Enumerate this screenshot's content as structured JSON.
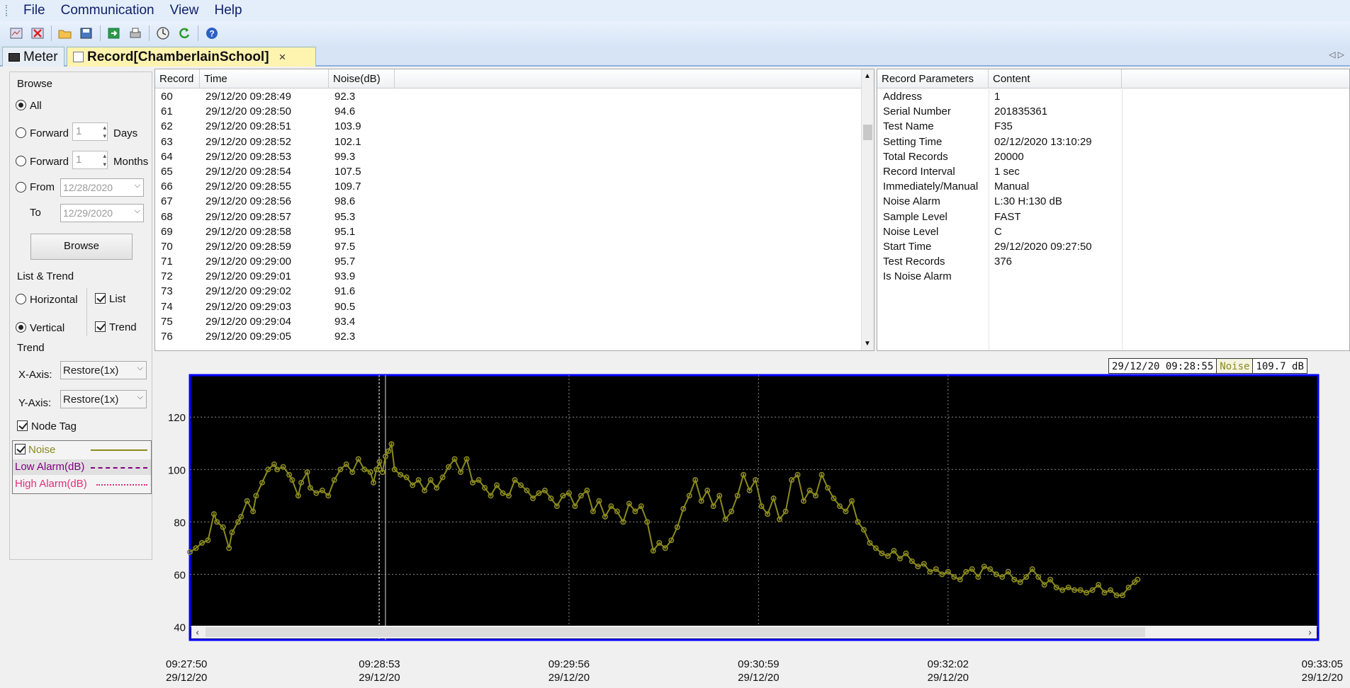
{
  "menu": {
    "items": [
      "File",
      "Communication",
      "View",
      "Help"
    ]
  },
  "toolbar": {
    "icons": [
      "view-icon",
      "delete-icon",
      "open-folder-icon",
      "save-icon",
      "export-icon",
      "print-icon",
      "clock-icon",
      "refresh-icon",
      "help-icon"
    ]
  },
  "tabs": [
    {
      "label": "Meter",
      "icon": "meter-icon"
    },
    {
      "label": "Record[ChamberlainSchool]",
      "icon": "record-icon",
      "close": "×"
    }
  ],
  "browse": {
    "group_label": "Browse",
    "all_label": "All",
    "forward_label": "Forward",
    "forward_days_value": "1",
    "days_label": "Days",
    "forward_months_value": "1",
    "months_label": "Months",
    "from_label": "From",
    "from_value": "12/28/2020",
    "to_label": "To",
    "to_value": "12/29/2020",
    "browse_button": "Browse"
  },
  "list_trend": {
    "group_label": "List & Trend",
    "horizontal_label": "Horizontal",
    "vertical_label": "Vertical",
    "list_label": "List",
    "trend_label": "Trend"
  },
  "trend": {
    "group_label": "Trend",
    "x_axis_label": "X-Axis:",
    "x_axis_value": "Restore(1x)",
    "y_axis_label": "Y-Axis:",
    "y_axis_value": "Restore(1x)",
    "node_tag_label": "Node Tag"
  },
  "legend": {
    "noise": "Noise",
    "low_alarm": "Low Alarm(dB)",
    "high_alarm": "High Alarm(dB)"
  },
  "records_table": {
    "columns": [
      "Record",
      "Time",
      "Noise(dB)"
    ],
    "rows": [
      [
        "60",
        "29/12/20 09:28:49",
        "92.3"
      ],
      [
        "61",
        "29/12/20 09:28:50",
        "94.6"
      ],
      [
        "62",
        "29/12/20 09:28:51",
        "103.9"
      ],
      [
        "63",
        "29/12/20 09:28:52",
        "102.1"
      ],
      [
        "64",
        "29/12/20 09:28:53",
        "99.3"
      ],
      [
        "65",
        "29/12/20 09:28:54",
        "107.5"
      ],
      [
        "66",
        "29/12/20 09:28:55",
        "109.7"
      ],
      [
        "67",
        "29/12/20 09:28:56",
        "98.6"
      ],
      [
        "68",
        "29/12/20 09:28:57",
        "95.3"
      ],
      [
        "69",
        "29/12/20 09:28:58",
        "95.1"
      ],
      [
        "70",
        "29/12/20 09:28:59",
        "97.5"
      ],
      [
        "71",
        "29/12/20 09:29:00",
        "95.7"
      ],
      [
        "72",
        "29/12/20 09:29:01",
        "93.9"
      ],
      [
        "73",
        "29/12/20 09:29:02",
        "91.6"
      ],
      [
        "74",
        "29/12/20 09:29:03",
        "90.5"
      ],
      [
        "75",
        "29/12/20 09:29:04",
        "93.4"
      ],
      [
        "76",
        "29/12/20 09:29:05",
        "92.3"
      ]
    ]
  },
  "params_table": {
    "columns": [
      "Record Parameters",
      "Content"
    ],
    "rows": [
      [
        "Address",
        "1"
      ],
      [
        "Serial Number",
        "201835361"
      ],
      [
        "Test Name",
        "F35"
      ],
      [
        "Setting Time",
        "02/12/2020 13:10:29"
      ],
      [
        "Total Records",
        "20000"
      ],
      [
        "Record Interval",
        "1 sec"
      ],
      [
        "Immediately/Manual",
        "Manual"
      ],
      [
        "Noise Alarm",
        "L:30 H:130 dB"
      ],
      [
        "Sample Level",
        "FAST"
      ],
      [
        "Noise Level",
        "C"
      ],
      [
        "Start Time",
        "29/12/2020 09:27:50"
      ],
      [
        "Test Records",
        "376"
      ],
      [
        "Is Noise Alarm",
        ""
      ]
    ]
  },
  "cursor_readout": {
    "time": "29/12/20 09:28:55",
    "series": "Noise",
    "value": "109.7 dB"
  },
  "colors": {
    "series": "#8a8a1e",
    "plot_bg": "#000000",
    "plot_border": "#0000ff",
    "low_alarm": "#800080",
    "high_alarm": "#e0307a"
  },
  "chart_data": {
    "type": "line",
    "ylim": [
      35,
      136
    ],
    "yticks": [
      40,
      60,
      80,
      100,
      120
    ],
    "xlim": [
      0,
      375
    ],
    "xticks": [
      {
        "t": 0,
        "time": "09:27:50",
        "date": "29/12/20"
      },
      {
        "t": 63,
        "time": "09:28:53",
        "date": "29/12/20"
      },
      {
        "t": 126,
        "time": "09:29:56",
        "date": "29/12/20"
      },
      {
        "t": 189,
        "time": "09:30:59",
        "date": "29/12/20"
      },
      {
        "t": 252,
        "time": "09:32:02",
        "date": "29/12/20"
      },
      {
        "t": 315,
        "time": "09:33:05",
        "date": "29/12/20"
      }
    ],
    "cursor_t": 65,
    "grid": true,
    "series": [
      {
        "name": "Noise",
        "x": [
          0,
          2,
          4,
          6,
          8,
          9,
          11,
          13,
          14,
          16,
          17,
          19,
          21,
          22,
          24,
          26,
          28,
          29,
          31,
          33,
          34,
          36,
          37,
          39,
          40,
          42,
          44,
          46,
          48,
          50,
          52,
          54,
          56,
          58,
          60,
          61,
          62,
          63,
          64,
          65,
          66,
          67,
          68,
          70,
          72,
          74,
          76,
          78,
          80,
          82,
          84,
          86,
          88,
          90,
          92,
          94,
          96,
          98,
          100,
          102,
          104,
          106,
          108,
          110,
          112,
          114,
          116,
          118,
          120,
          122,
          124,
          126,
          128,
          130,
          132,
          134,
          136,
          138,
          140,
          142,
          144,
          146,
          148,
          150,
          152,
          154,
          156,
          158,
          160,
          162,
          164,
          166,
          168,
          170,
          172,
          174,
          176,
          178,
          180,
          182,
          184,
          186,
          188,
          190,
          192,
          194,
          196,
          198,
          200,
          202,
          204,
          206,
          208,
          210,
          212,
          214,
          216,
          218,
          220,
          222,
          224,
          226,
          228,
          230,
          232,
          234,
          236,
          238,
          240,
          242,
          244,
          246,
          248,
          250,
          252,
          254,
          256,
          258,
          260,
          262,
          264,
          266,
          268,
          270,
          272,
          274,
          276,
          278,
          280,
          282,
          284,
          286,
          288,
          290,
          292,
          294,
          296,
          298,
          300,
          302,
          304,
          306,
          308,
          310,
          312,
          314,
          315
        ],
        "y": [
          68.5,
          70,
          72,
          73,
          83,
          80,
          78,
          70,
          76,
          80,
          82,
          88,
          84,
          90,
          95,
          100,
          102,
          100,
          101,
          98,
          96,
          90,
          95,
          99,
          93,
          91,
          92,
          90,
          96,
          100,
          102,
          99,
          104,
          100,
          99,
          95,
          100,
          103,
          99,
          105,
          107,
          109.7,
          100,
          98,
          97,
          94,
          96,
          92,
          96,
          93,
          97,
          101,
          104,
          99,
          104,
          95,
          96,
          93,
          90,
          94,
          91,
          90,
          96,
          94,
          92,
          89,
          91,
          92,
          89,
          86,
          90,
          91,
          86,
          90,
          92,
          84,
          88,
          82,
          86,
          84,
          80,
          87,
          84,
          86,
          80,
          69,
          72,
          70,
          73,
          78,
          85,
          90,
          96,
          88,
          92,
          86,
          90,
          81,
          84,
          90,
          98,
          92,
          96,
          86,
          83,
          89,
          81,
          84,
          96,
          98,
          88,
          92,
          90,
          98,
          93,
          89,
          86,
          84,
          88,
          80,
          77,
          72,
          70,
          68,
          67,
          69,
          66,
          68,
          65,
          63,
          64,
          61,
          62,
          60,
          61,
          59,
          58,
          61,
          62,
          59,
          63,
          62,
          60,
          59,
          61,
          58,
          57,
          59,
          62,
          59,
          56,
          58,
          55,
          54,
          55,
          54,
          54,
          53,
          54,
          56,
          53,
          54,
          52,
          52,
          55,
          57,
          58
        ]
      }
    ]
  }
}
